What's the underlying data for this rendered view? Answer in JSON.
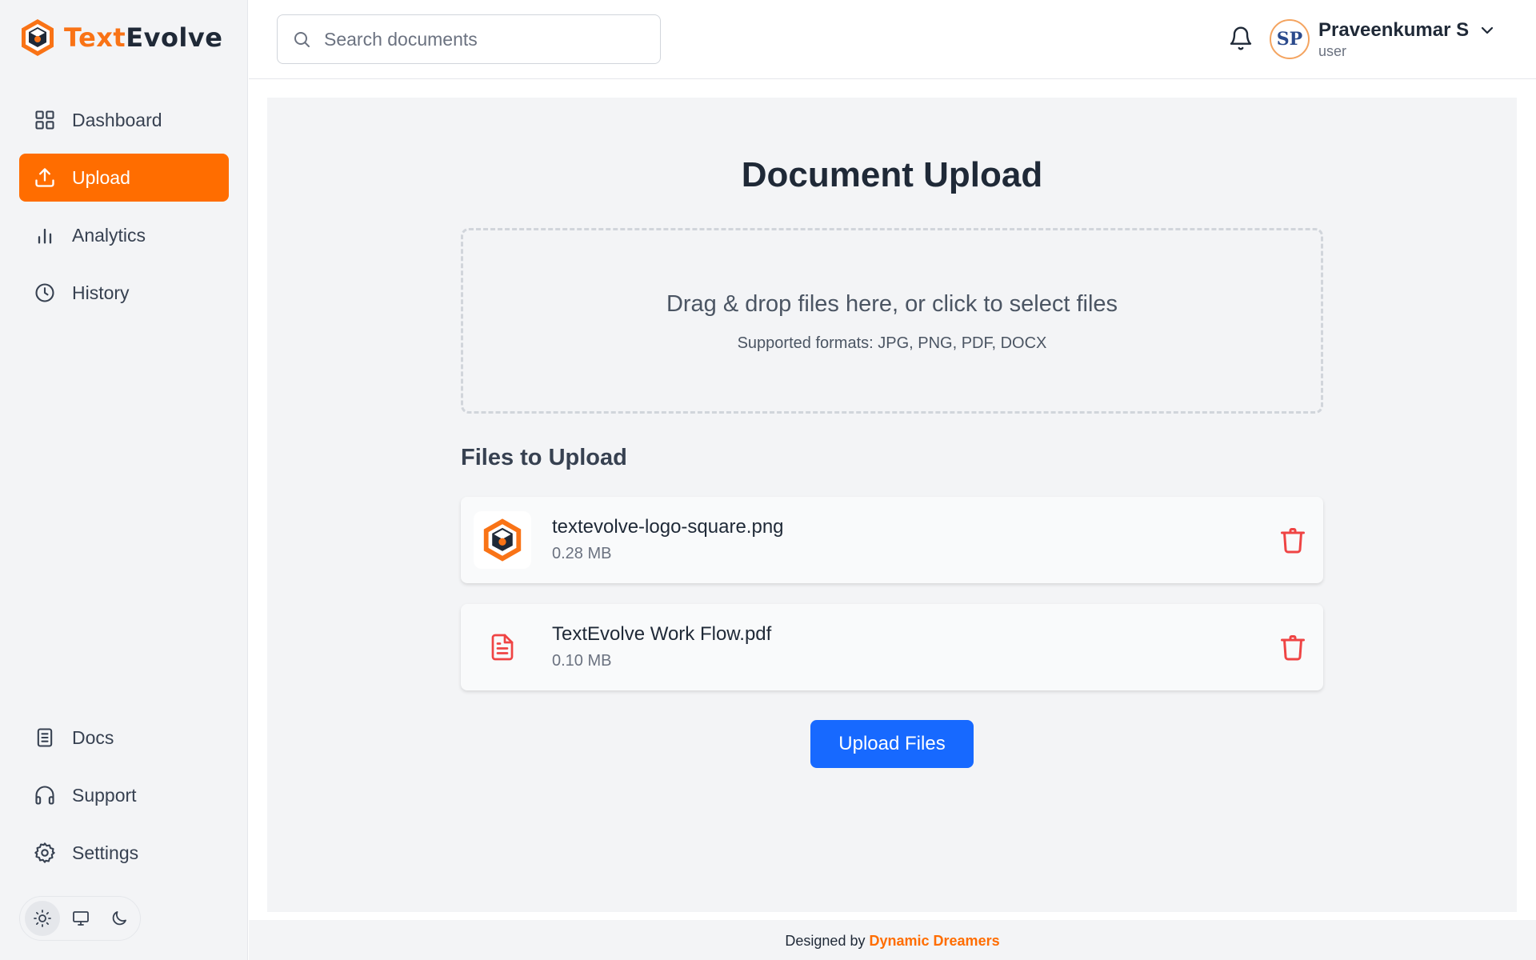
{
  "app": {
    "logo_part1": "Text",
    "logo_part2": "Evolve",
    "brand_color": "#ff6d00"
  },
  "sidebar": {
    "items": [
      {
        "label": "Dashboard",
        "icon": "grid-icon"
      },
      {
        "label": "Upload",
        "icon": "upload-icon",
        "active": true
      },
      {
        "label": "Analytics",
        "icon": "bar-chart-icon"
      },
      {
        "label": "History",
        "icon": "clock-icon"
      }
    ],
    "bottom_items": [
      {
        "label": "Docs",
        "icon": "document-icon"
      },
      {
        "label": "Support",
        "icon": "headphones-icon"
      },
      {
        "label": "Settings",
        "icon": "gear-icon"
      }
    ],
    "theme_options": [
      "sun-icon",
      "monitor-icon",
      "moon-icon"
    ],
    "theme_selected": "sun-icon"
  },
  "header": {
    "search_placeholder": "Search documents",
    "user": {
      "name": "Praveenkumar S",
      "role": "user",
      "avatar_initials": "SP"
    }
  },
  "main": {
    "title": "Document Upload",
    "dropzone": {
      "text": "Drag & drop files here, or click to select files",
      "subtext": "Supported formats: JPG, PNG, PDF, DOCX"
    },
    "files_heading": "Files to Upload",
    "files": [
      {
        "name": "textevolve-logo-square.png",
        "size": "0.28 MB",
        "icon": "logo-thumbnail"
      },
      {
        "name": "TextEvolve Work Flow.pdf",
        "size": "0.10 MB",
        "icon": "file-text-icon"
      }
    ],
    "upload_button": "Upload Files",
    "upload_button_color": "#1769ff",
    "delete_color": "#ef4444"
  },
  "footer": {
    "prefix": "Designed by",
    "brand": "Dynamic Dreamers"
  }
}
